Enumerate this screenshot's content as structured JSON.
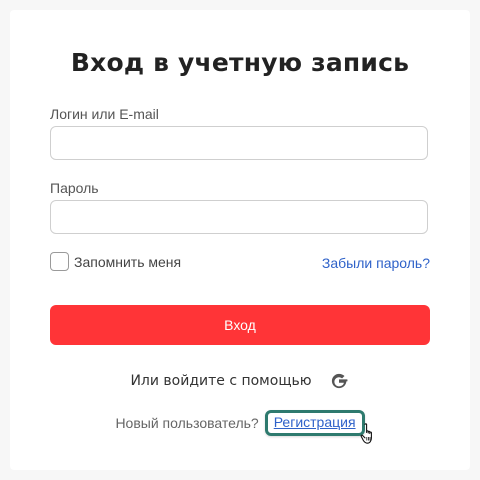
{
  "form": {
    "title": "Вход в учетную запись",
    "login_label": "Логин или E-mail",
    "login_value": "",
    "password_label": "Пароль",
    "password_value": "",
    "remember_label": "Запомнить меня",
    "remember_checked": false,
    "forgot_link": "Забыли пароль?",
    "submit_label": "Вход"
  },
  "social": {
    "text": "Или войдите с помощью",
    "providers": [
      "google-icon"
    ]
  },
  "signup": {
    "text": "Новый пользователь?",
    "link": "Регистрация"
  },
  "colors": {
    "primary_button": "#ff3437",
    "link": "#2f62c9",
    "highlight_border": "#2e7a6e"
  }
}
